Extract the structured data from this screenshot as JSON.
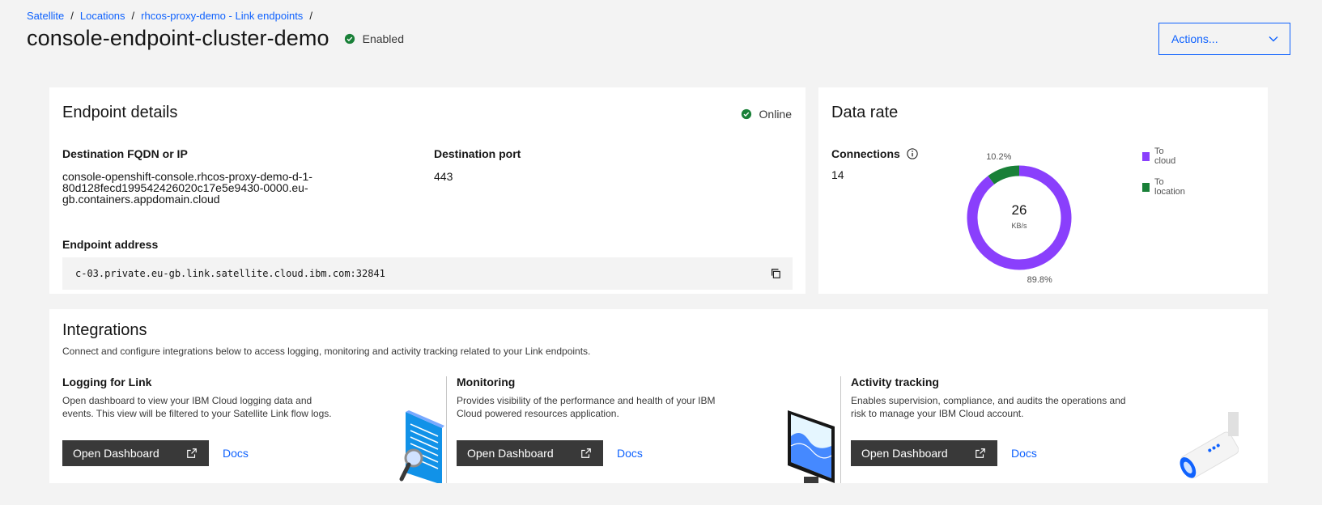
{
  "breadcrumb": [
    {
      "label": "Satellite"
    },
    {
      "label": "Locations"
    },
    {
      "label": "rhcos-proxy-demo - Link endpoints"
    }
  ],
  "breadcrumb_separator": "/",
  "header": {
    "title": "console-endpoint-cluster-demo",
    "status": "Enabled",
    "status_color": "#24a148",
    "actions_label": "Actions..."
  },
  "endpoint": {
    "heading": "Endpoint details",
    "online_label": "Online",
    "fqdn_label": "Destination FQDN or IP",
    "fqdn_lines": [
      "console-openshift-console.rhcos-proxy-demo-d-1-",
      "80d128fecd199542426020c17e5e9430-0000.eu-",
      "gb.containers.appdomain.cloud"
    ],
    "port_label": "Destination port",
    "port_value": "443",
    "address_label": "Endpoint address",
    "address_value": "c-03.private.eu-gb.link.satellite.cloud.ibm.com:32841"
  },
  "data_rate": {
    "heading": "Data rate",
    "connections_label": "Connections",
    "connections_value": "14",
    "center_value": "26",
    "center_unit": "KB/s",
    "legend": [
      {
        "line1": "To",
        "line2": "cloud",
        "color": "#8a3ffc"
      },
      {
        "line1": "To",
        "line2": "location",
        "color": "#198038"
      }
    ]
  },
  "chart_data": {
    "type": "pie",
    "variant": "donut",
    "categories": [
      "To cloud",
      "To location"
    ],
    "values": [
      89.8,
      10.2
    ],
    "labels": [
      "89.8%",
      "10.2%"
    ],
    "colors": [
      "#8a3ffc",
      "#198038"
    ],
    "title": "",
    "legend_position": "right"
  },
  "integrations": {
    "heading": "Integrations",
    "subtitle": "Connect and configure integrations below to access logging, monitoring and activity tracking related to your Link endpoints.",
    "items": [
      {
        "title": "Logging for Link",
        "desc_lines": [
          "Open dashboard to view your IBM Cloud logging data and",
          "events. This view will be filtered to your Satellite Link flow logs."
        ],
        "button": "Open Dashboard",
        "docs": "Docs"
      },
      {
        "title": "Monitoring",
        "desc_lines": [
          "Provides visibility of the performance and health of your IBM",
          "Cloud powered resources application."
        ],
        "button": "Open Dashboard",
        "docs": "Docs"
      },
      {
        "title": "Activity tracking",
        "desc_lines": [
          "Enables supervision, compliance, and audits the operations and",
          "risk to manage your IBM Cloud account."
        ],
        "button": "Open Dashboard",
        "docs": "Docs"
      }
    ]
  }
}
